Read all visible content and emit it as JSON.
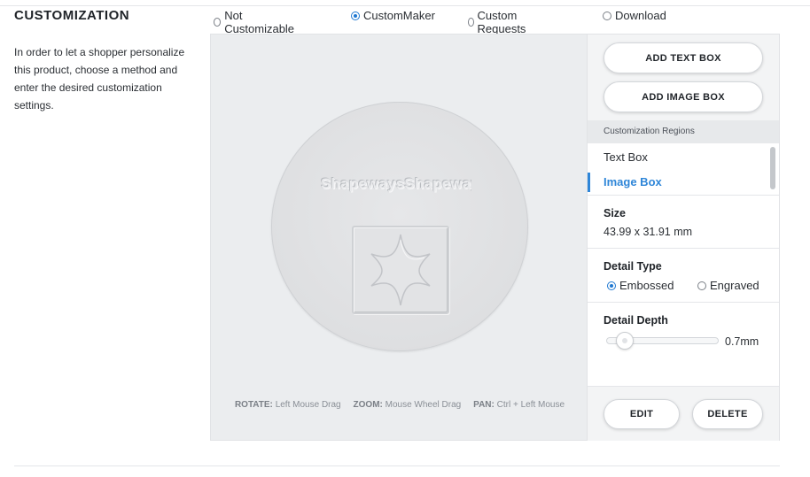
{
  "section": {
    "title": "CUSTOMIZATION",
    "description": "In order to let a shopper personalize this product, choose a method and enter the desired customization settings."
  },
  "method_options": [
    {
      "label": "Not Customizable",
      "selected": false
    },
    {
      "label": "CustomMaker",
      "selected": true
    },
    {
      "label": "Custom Requests",
      "selected": false
    },
    {
      "label": "Download",
      "selected": false
    }
  ],
  "viewer": {
    "embossed_text": "ShapewaysShapeways",
    "controls": {
      "rotate_key": "ROTATE:",
      "rotate_value": "Left Mouse Drag",
      "zoom_key": "ZOOM:",
      "zoom_value": "Mouse Wheel Drag",
      "pan_key": "PAN:",
      "pan_value": "Ctrl + Left Mouse"
    }
  },
  "panel": {
    "add_text_box_label": "ADD TEXT BOX",
    "add_image_box_label": "ADD IMAGE BOX",
    "regions_header": "Customization Regions",
    "regions": [
      {
        "label": "Text Box",
        "active": false
      },
      {
        "label": "Image Box",
        "active": true
      }
    ],
    "size_label": "Size",
    "size_value": "43.99 x 31.91 mm",
    "detail_type_label": "Detail Type",
    "detail_type_options": [
      {
        "label": "Embossed",
        "selected": true
      },
      {
        "label": "Engraved",
        "selected": false
      }
    ],
    "detail_depth_label": "Detail Depth",
    "detail_depth_value": "0.7mm",
    "detail_depth_fraction": 0.1,
    "edit_label": "EDIT",
    "delete_label": "DELETE"
  },
  "colors": {
    "accent": "#2f86d8",
    "radio_checked": "#1f78d1"
  }
}
